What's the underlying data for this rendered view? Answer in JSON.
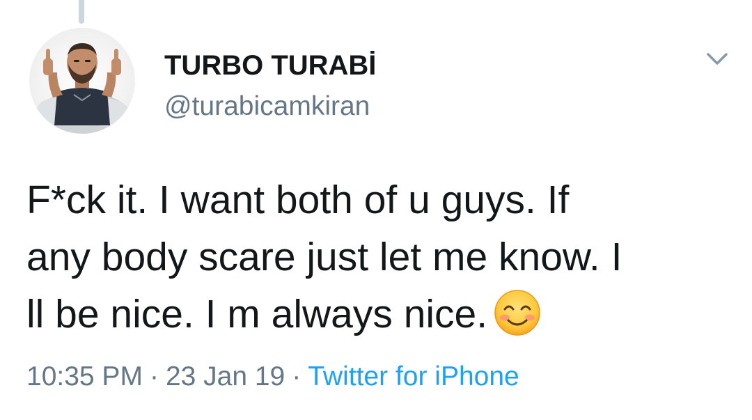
{
  "tweet": {
    "author": {
      "display_name": "TURBO TURABİ",
      "handle": "@turabicamkiran",
      "avatar_icon": "profile-photo"
    },
    "text_lines": [
      "F*ck it. I want both of u guys. If",
      "any body scare just let me know. I",
      "ll be nice. I m always nice."
    ],
    "emoji": "smiling-face-with-smiling-eyes",
    "time": "10:35 PM",
    "date": "23 Jan 19",
    "separator": "·",
    "source": "Twitter for iPhone",
    "menu_icon": "chevron-down-icon"
  },
  "colors": {
    "text": "#14171a",
    "secondary": "#657786",
    "link": "#1da1f2",
    "thread_line": "#ccd6dd"
  }
}
